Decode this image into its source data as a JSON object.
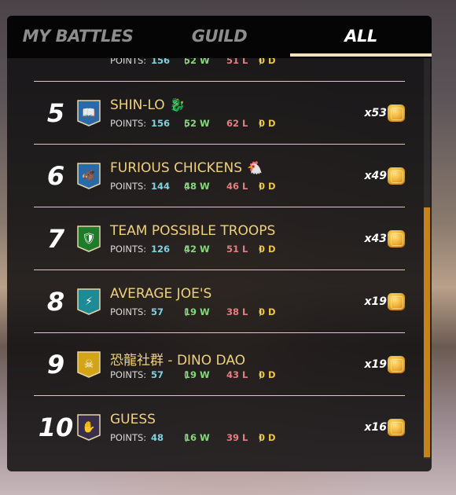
{
  "tabs": [
    {
      "label": "MY BATTLES"
    },
    {
      "label": "GUILD"
    },
    {
      "label": "ALL"
    }
  ],
  "partial_row": {
    "points_label": "POINTS:",
    "points": "156",
    "w_prefix": "(",
    "wins": "52 W",
    "losses": "51 L",
    "draws": "0 D",
    "d_suffix": ")"
  },
  "rows": [
    {
      "rank": "5",
      "name": "SHIN-LO",
      "deco": "🐉",
      "points_label": "POINTS:",
      "points": "156",
      "w_prefix": "(",
      "wins": "52 W",
      "losses": "62 L",
      "draws": "0 D",
      "d_suffix": ")",
      "multiplier": "x53",
      "emblem_color": "#2a6aa6",
      "emblem_icon": "book-emblem"
    },
    {
      "rank": "6",
      "name": "FURIOUS CHICKENS",
      "deco": "🐔",
      "points_label": "POINTS:",
      "points": "144",
      "w_prefix": "(",
      "wins": "48 W",
      "losses": "46 L",
      "draws": "0 D",
      "d_suffix": ")",
      "multiplier": "x49",
      "emblem_color": "#2a6aa6",
      "emblem_icon": "boar-emblem"
    },
    {
      "rank": "7",
      "name": "TEAM POSSIBLE TROOPS",
      "deco": "",
      "points_label": "POINTS:",
      "points": "126",
      "w_prefix": "(",
      "wins": "42 W",
      "losses": "51 L",
      "draws": "0 D",
      "d_suffix": ")",
      "multiplier": "x43",
      "emblem_color": "#1f7a2a",
      "emblem_icon": "shield-emblem"
    },
    {
      "rank": "8",
      "name": "AVERAGE JOE'S",
      "deco": "",
      "points_label": "POINTS:",
      "points": "57",
      "w_prefix": "(",
      "wins": "19 W",
      "losses": "38 L",
      "draws": "0 D",
      "d_suffix": ")",
      "multiplier": "x19",
      "emblem_color": "#1d8a95",
      "emblem_icon": "lightning-emblem"
    },
    {
      "rank": "9",
      "name": "恐龍社群 - DINO DAO",
      "deco": "",
      "points_label": "POINTS:",
      "points": "57",
      "w_prefix": "(",
      "wins": "19 W",
      "losses": "43 L",
      "draws": "0 D",
      "d_suffix": ")",
      "multiplier": "x19",
      "emblem_color": "#d4a418",
      "emblem_icon": "skull-emblem"
    },
    {
      "rank": "10",
      "name": "GUESS",
      "deco": "",
      "points_label": "POINTS:",
      "points": "48",
      "w_prefix": "(",
      "wins": "16 W",
      "losses": "39 L",
      "draws": "0 D",
      "d_suffix": ")",
      "multiplier": "x16",
      "emblem_color": "#3a2f4a",
      "emblem_icon": "hand-emblem"
    }
  ]
}
